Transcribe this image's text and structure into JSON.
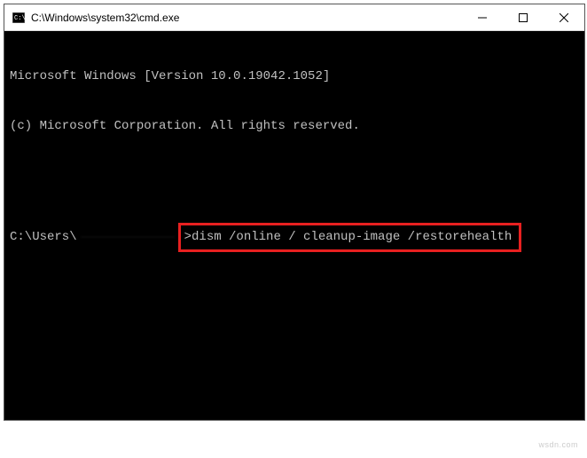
{
  "titlebar": {
    "title": "C:\\Windows\\system32\\cmd.exe"
  },
  "terminal": {
    "line1": "Microsoft Windows [Version 10.0.19042.1052]",
    "line2": "(c) Microsoft Corporation. All rights reserved.",
    "prompt_prefix": "C:\\Users\\",
    "command": ">dism /online / cleanup-image /restorehealth"
  },
  "watermark": "wsdn.com"
}
